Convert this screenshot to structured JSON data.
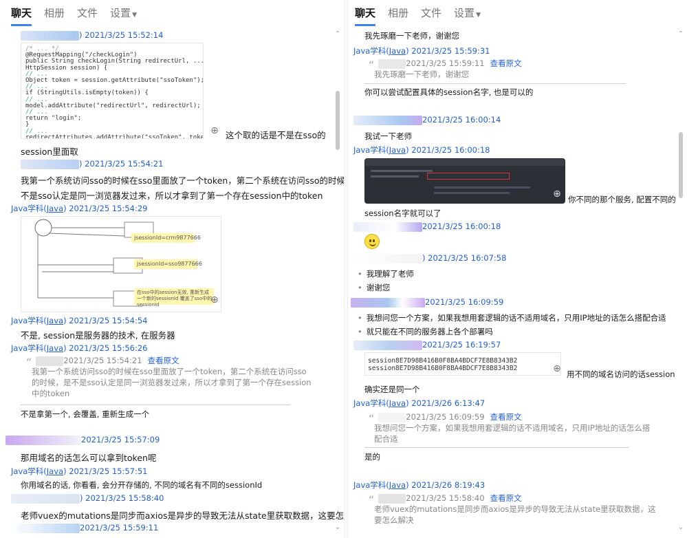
{
  "tabs": [
    {
      "label": "聊天"
    },
    {
      "label": "相册"
    },
    {
      "label": "文件"
    },
    {
      "label": "设置"
    }
  ],
  "colors": {
    "link": "#1e5fd6",
    "accent": "#3b82f6",
    "blur_blue": "#a8c8f0",
    "blur_purple": "#c8a8f0"
  },
  "icons": {
    "zoom": "zoom-in-icon",
    "caret": "caret-down-icon",
    "scroll_up": "chevron-up-icon",
    "scroll_down": "chevron-down-icon"
  },
  "left": {
    "m1": {
      "time": ") 2021/3/25 15:52:14",
      "inline_text": "这个取的话是不是在sso的",
      "text2": "session里面取"
    },
    "m2": {
      "time": ") 2021/3/25 15:54:21",
      "line1": "我第一个系统访问sso的时候在sso里面放了一个token，第二个系统在访问sso的时候，是",
      "line2": "不是sso认定是同一浏览器发过来，所以才拿到了第一个存在session中的token"
    },
    "m3": {
      "sender": "Java学科(",
      "sender_link": "Java",
      "time": ") 2021/3/25 15:54:29",
      "diagram": {
        "note1": "jsessionId=crm9877666",
        "note2": "jsessionId=sso9877666",
        "note3": "在sso中的session无效, 重新生成一个新的sessionId 覆盖了sso中的sessionId"
      }
    },
    "m4": {
      "sender": "Java学科(",
      "sender_link": "Java",
      "time": ") 2021/3/25 15:54:54",
      "text": "不是, session是服务器的技术, 在服务器"
    },
    "m5": {
      "sender": "Java学科(",
      "sender_link": "Java",
      "time": ") 2021/3/25 15:56:26",
      "quote_time": "2021/3/25 15:54:21",
      "quote_link": "查看原文",
      "quote_lines": [
        "我第一个系统访问sso的时候在sso里面放了一个token，第二个系统在访问sso",
        "的时候，是不是sso认定是同一浏览器发过来，所以才拿到了第一个存在session",
        "中的token"
      ],
      "reply": "不是拿第一个, 会覆盖, 重新生成一个"
    },
    "m6": {
      "time": "2021/3/25 15:57:09",
      "text": "那用域名的话怎么可以拿到token呢"
    },
    "m7": {
      "sender": "Java学科(",
      "sender_link": "Java",
      "time": ") 2021/3/25 15:57:51",
      "text": "你用域名的话, 你看看, 会分开存储的, 不同的域名有不同的sessionId"
    },
    "m8": {
      "time": ") 2021/3/25 15:58:40",
      "text": "老师vuex的mutations是同步而axios是异步的导致无法从state里获取数据，这要怎么解决"
    },
    "m9": {
      "time": "2021/3/25 15:59:11"
    }
  },
  "right": {
    "r0": {
      "text": "我先琢磨一下老师，谢谢您"
    },
    "r1": {
      "sender": "Java学科(",
      "sender_link": "Java",
      "time": ") 2021/3/25 15:59:31",
      "quote_time": "2021/3/25 15:59:11",
      "quote_link": "查看原文",
      "quote_line": "我先琢磨一下老师，谢谢您",
      "reply": "你可以尝试配置具体的session名字, 也是可以的"
    },
    "r2": {
      "time": "2021/3/25 16:00:14",
      "text": "我试一下老师"
    },
    "r3": {
      "sender": "Java学科(",
      "sender_link": "Java",
      "time": ") 2021/3/25 16:00:18",
      "inline_text": "你不同的那个服务, 配置不同的",
      "text2": "session名字就可以了"
    },
    "r4": {
      "time": "2021/3/25 16:00:18"
    },
    "r5": {
      "time": ") 2021/3/25 16:07:58",
      "lines": [
        "我理解了老师",
        "谢谢您"
      ]
    },
    "r6": {
      "time": "2021/3/25 16:09:59",
      "lines": [
        "我想问您一个方案，如果我想用套逻辑的话不适用域名，只用IP地址的话怎么搭配合适",
        "就只能在不同的服务器上各个部署吗"
      ]
    },
    "r7": {
      "time": "2021/3/25 16:19:57",
      "code": [
        "session8E7D98B416B0F8BA4BDCF7E8B8343B2",
        "session8E7D98B416B0F8BA4BDCF7E8B8343B2"
      ],
      "inline_text": "用不同的域名访问的话session",
      "text2": "确实还是同一个"
    },
    "r8": {
      "sender": "Java学科(",
      "sender_link": "Java",
      "time": ") 2021/3/26 6:13:47",
      "quote_time": "2021/3/25 16:09:59",
      "quote_link": "查看原文",
      "quote_lines": [
        "我想问您一个方案，如果我想用套逻辑的话不适用域名，只用IP地址的话怎么搭",
        "配合适"
      ],
      "reply": "是的"
    },
    "r9": {
      "sender": "Java学科(",
      "sender_link": "Java",
      "time": ") 2021/3/26 8:19:43",
      "quote_time": "2021/3/25 15:58:40",
      "quote_link": "查看原文",
      "quote_lines": [
        "老师vuex的mutations是同步而axios是异步的导致无法从state里获取数据，这",
        "要怎么解决"
      ]
    }
  }
}
